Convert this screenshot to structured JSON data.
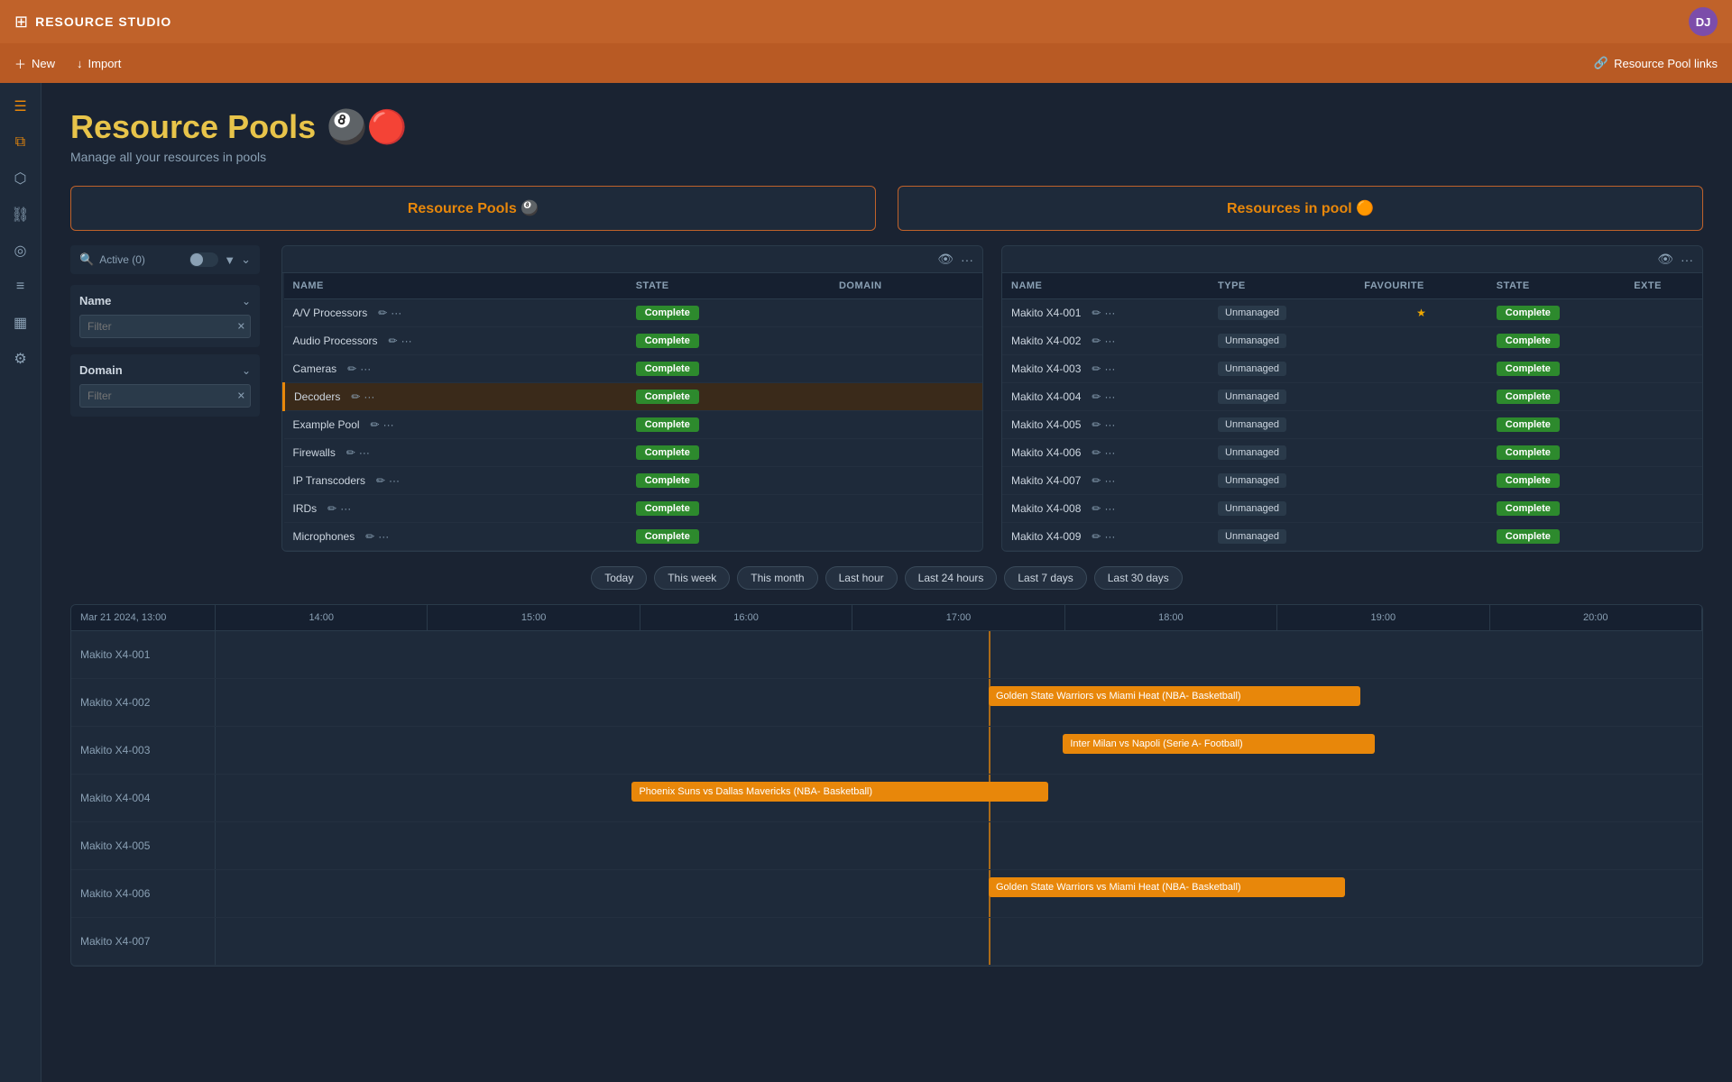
{
  "app": {
    "title": "RESOURCE STUDIO",
    "avatar": "DJ"
  },
  "topbar": {
    "new_label": "New",
    "import_label": "Import",
    "resource_pool_link": "Resource Pool links"
  },
  "sidebar": {
    "icons": [
      {
        "name": "menu-icon",
        "symbol": "☰",
        "active": false
      },
      {
        "name": "layers-icon",
        "symbol": "⧉",
        "active": true
      },
      {
        "name": "cube-icon",
        "symbol": "⬡",
        "active": false
      },
      {
        "name": "link-icon",
        "symbol": "🔗",
        "active": false
      },
      {
        "name": "target-icon",
        "symbol": "◎",
        "active": false
      },
      {
        "name": "document-icon",
        "symbol": "☰",
        "active": false
      },
      {
        "name": "chart-icon",
        "symbol": "📊",
        "active": false
      },
      {
        "name": "settings-icon",
        "symbol": "⚙",
        "active": false
      }
    ]
  },
  "page": {
    "title": "Resource Pools",
    "title_emoji": "🎱🔴",
    "subtitle": "Manage all your resources in pools"
  },
  "panels": {
    "left_title": "Resource Pools 🎱",
    "right_title": "Resources in pool 🟠"
  },
  "filter": {
    "active_label": "Active (0)",
    "name_section": "Name",
    "name_placeholder": "Filter",
    "domain_section": "Domain",
    "domain_placeholder": "Filter"
  },
  "resource_pools_table": {
    "columns": [
      "NAME",
      "STATE",
      "DOMAIN"
    ],
    "rows": [
      {
        "name": "A/V Processors",
        "state": "Complete",
        "selected": false
      },
      {
        "name": "Audio Processors",
        "state": "Complete",
        "selected": false
      },
      {
        "name": "Cameras",
        "state": "Complete",
        "selected": false
      },
      {
        "name": "Decoders",
        "state": "Complete",
        "selected": true
      },
      {
        "name": "Example Pool",
        "state": "Complete",
        "selected": false
      },
      {
        "name": "Firewalls",
        "state": "Complete",
        "selected": false
      },
      {
        "name": "IP Transcoders",
        "state": "Complete",
        "selected": false
      },
      {
        "name": "IRDs",
        "state": "Complete",
        "selected": false
      },
      {
        "name": "Microphones",
        "state": "Complete",
        "selected": false
      }
    ]
  },
  "resources_table": {
    "columns": [
      "NAME",
      "TYPE",
      "FAVOURITE",
      "STATE",
      "EXTE"
    ],
    "rows": [
      {
        "name": "Makito X4-001",
        "type": "Unmanaged",
        "favourite": true,
        "state": "Complete"
      },
      {
        "name": "Makito X4-002",
        "type": "Unmanaged",
        "favourite": false,
        "state": "Complete"
      },
      {
        "name": "Makito X4-003",
        "type": "Unmanaged",
        "favourite": false,
        "state": "Complete"
      },
      {
        "name": "Makito X4-004",
        "type": "Unmanaged",
        "favourite": false,
        "state": "Complete"
      },
      {
        "name": "Makito X4-005",
        "type": "Unmanaged",
        "favourite": false,
        "state": "Complete"
      },
      {
        "name": "Makito X4-006",
        "type": "Unmanaged",
        "favourite": false,
        "state": "Complete"
      },
      {
        "name": "Makito X4-007",
        "type": "Unmanaged",
        "favourite": false,
        "state": "Complete"
      },
      {
        "name": "Makito X4-008",
        "type": "Unmanaged",
        "favourite": false,
        "state": "Complete"
      },
      {
        "name": "Makito X4-009",
        "type": "Unmanaged",
        "favourite": false,
        "state": "Complete"
      }
    ]
  },
  "time_filters": [
    "Today",
    "This week",
    "This month",
    "Last hour",
    "Last 24 hours",
    "Last 7 days",
    "Last 30 days"
  ],
  "timeline": {
    "date": "Mar 21 2024, 13:00",
    "time_markers": [
      "14:00",
      "15:00",
      "16:00",
      "17:00",
      "18:00",
      "19:00",
      "20:00"
    ],
    "rows": [
      {
        "label": "Makito X4-001",
        "events": []
      },
      {
        "label": "Makito X4-002",
        "events": [
          {
            "text": "Golden State Warriors vs Miami Heat (NBA- Basketball)",
            "left": "52%",
            "width": "25%"
          }
        ]
      },
      {
        "label": "Makito X4-003",
        "events": [
          {
            "text": "Inter Milan vs Napoli (Serie A- Football)",
            "left": "57%",
            "width": "21%"
          }
        ]
      },
      {
        "label": "Makito X4-004",
        "events": [
          {
            "text": "Phoenix Suns vs Dallas Mavericks (NBA- Basketball)",
            "left": "28%",
            "width": "28%"
          }
        ]
      },
      {
        "label": "Makito X4-005",
        "events": []
      },
      {
        "label": "Makito X4-006",
        "events": [
          {
            "text": "Golden State Warriors vs Miami Heat (NBA- Basketball)",
            "left": "52%",
            "width": "24%"
          }
        ]
      },
      {
        "label": "Makito X4-007",
        "events": []
      }
    ],
    "current_time_pct": "52%"
  }
}
